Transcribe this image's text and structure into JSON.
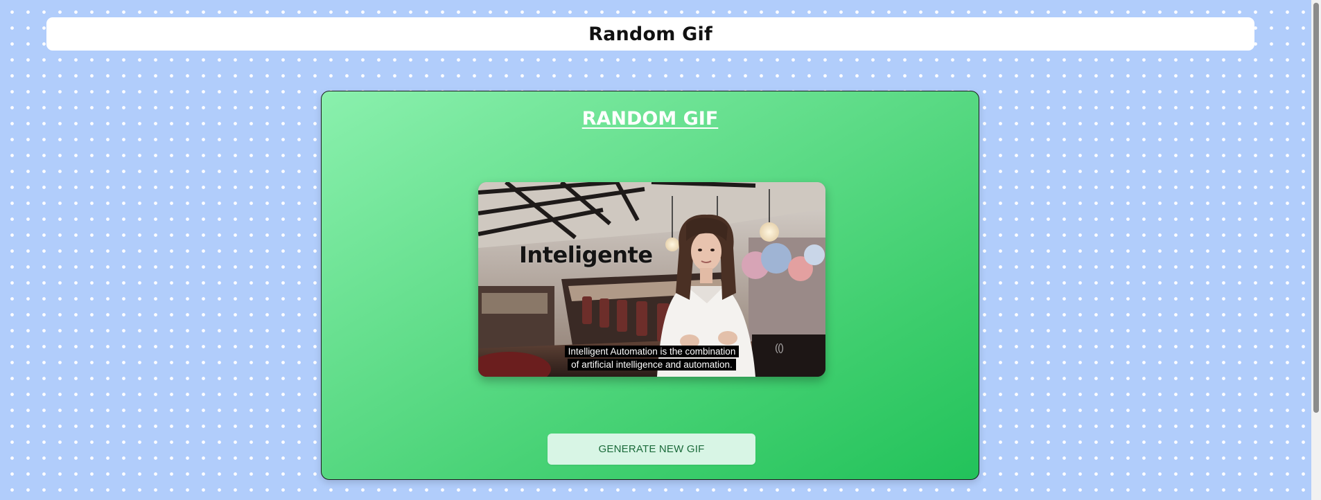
{
  "header": {
    "title": "Random Gif"
  },
  "card": {
    "title": "RANDOM GIF",
    "gif": {
      "overlay_text": "Inteligente",
      "caption_line_1": "Intelligent Automation is the combination",
      "caption_line_2": "of artificial intelligence and automation.",
      "watermark": "(()"
    },
    "button_label": "GENERATE NEW GIF"
  },
  "colors": {
    "page_background": "#b1cdfb",
    "card_gradient_start": "#8af0ad",
    "card_gradient_end": "#22c25a",
    "button_background": "#d8f5e5",
    "button_text": "#1b6a3a"
  }
}
